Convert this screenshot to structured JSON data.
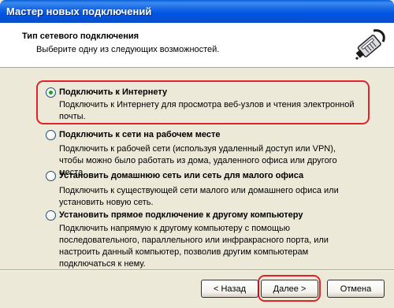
{
  "window": {
    "title": "Мастер новых подключений"
  },
  "header": {
    "title": "Тип сетевого подключения",
    "subtitle": "Выберите одну из следующих возможностей."
  },
  "options": [
    {
      "label": "Подключить к Интернету",
      "desc": "Подключить к Интернету для просмотра веб-узлов и чтения  электронной почты.",
      "selected": true
    },
    {
      "label": "Подключить к сети на рабочем месте",
      "desc": "Подключить к рабочей сети (используя удаленный доступ или VPN), чтобы можно было работать из дома, удаленного офиса или другого места.",
      "selected": false
    },
    {
      "label": "Установить домашнюю сеть или сеть для малого офиса",
      "desc": "Подключить к существующей сети малого или домашнего офиса или установить новую сеть.",
      "selected": false
    },
    {
      "label": "Установить прямое подключение к другому компьютеру",
      "desc": "Подключить напрямую к другому компьютеру с помощью последовательного, параллельного или инфракрасного порта, или настроить данный компьютер, позволив другим  компьютерам подключаться к нему.",
      "selected": false
    }
  ],
  "buttons": {
    "back": "< Назад",
    "next": "Далее >",
    "cancel": "Отмена"
  },
  "highlight_color": "#E0222A",
  "icons": {
    "header": "network-cable-plug-icon"
  }
}
